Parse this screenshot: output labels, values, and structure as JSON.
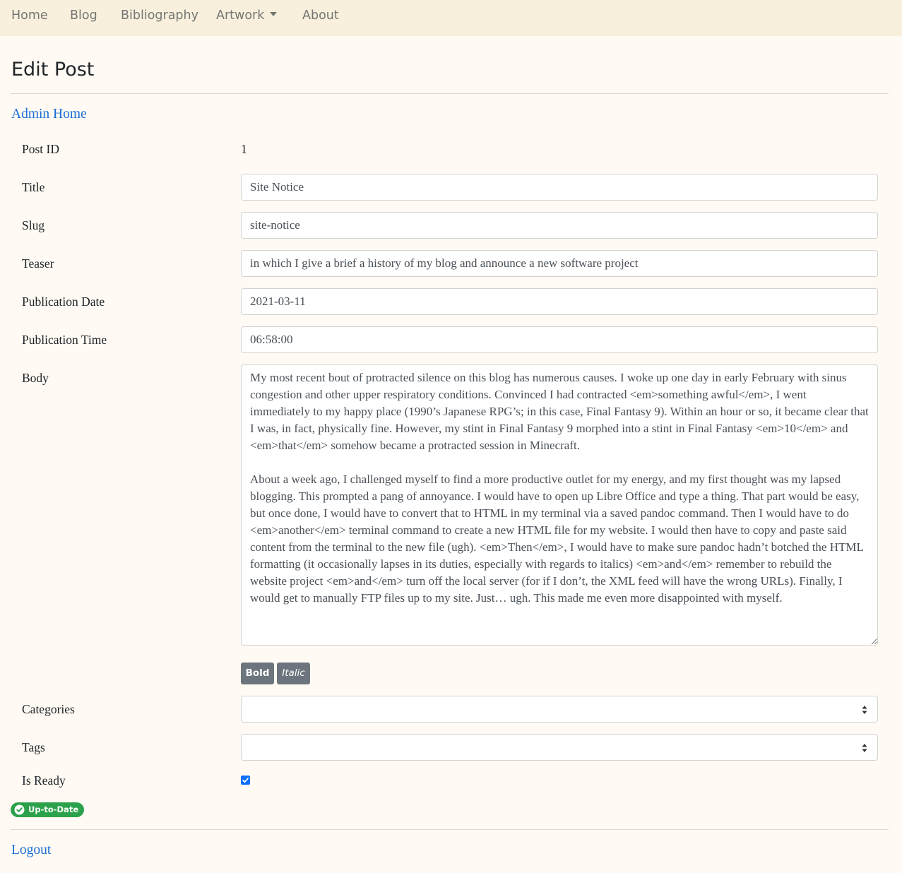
{
  "nav": {
    "items": [
      {
        "label": "Home"
      },
      {
        "label": "Blog"
      },
      {
        "label": "Bibliography"
      },
      {
        "label": "Artwork",
        "dropdown": true
      },
      {
        "label": "About"
      }
    ]
  },
  "page": {
    "title": "Edit Post",
    "admin_link": "Admin Home",
    "logout_link": "Logout"
  },
  "form": {
    "post_id_label": "Post ID",
    "post_id_value": "1",
    "title_label": "Title",
    "title_value": "Site Notice",
    "slug_label": "Slug",
    "slug_value": "site-notice",
    "teaser_label": "Teaser",
    "teaser_value": "in which I give a brief a history of my blog and announce a new software project",
    "pub_date_label": "Publication Date",
    "pub_date_value": "2021-03-11",
    "pub_time_label": "Publication Time",
    "pub_time_value": "06:58:00",
    "body_label": "Body",
    "body_value": "My most recent bout of protracted silence on this blog has numerous causes. I woke up one day in early February with sinus congestion and other upper respiratory conditions. Convinced I had contracted <em>something awful</em>, I went immediately to my happy place (1990’s Japanese RPG’s; in this case, Final Fantasy 9). Within an hour or so, it became clear that I was, in fact, physically fine. However, my stint in Final Fantasy 9 morphed into a stint in Final Fantasy <em>10</em> and <em>that</em> somehow became a protracted session in Minecraft.\n\nAbout a week ago, I challenged myself to find a more productive outlet for my energy, and my first thought was my lapsed blogging. This prompted a pang of annoyance. I would have to open up Libre Office and type a thing. That part would be easy, but once done, I would have to convert that to HTML in my terminal via a saved pandoc command. Then I would have to do <em>another</em> terminal command to create a new HTML file for my website. I would then have to copy and paste said content from the terminal to the new file (ugh). <em>Then</em>, I would have to make sure pandoc hadn’t botched the HTML formatting (it occasionally lapses in its duties, especially with regards to italics) <em>and</em> remember to rebuild the website project <em>and</em> turn off the local server (for if I don’t, the XML feed will have the wrong URLs). Finally, I would get to manually FTP files up to my site. Just… ugh. This made me even more disappointed with myself.",
    "bold_button": "Bold",
    "italic_button": "Italic",
    "categories_label": "Categories",
    "tags_label": "Tags",
    "is_ready_label": "Is Ready",
    "is_ready_checked": true,
    "status_badge": "Up-to-Date"
  },
  "colors": {
    "navbar_bg": "#f8f0dc",
    "page_bg": "#fffaf3",
    "link": "#1b6ed6",
    "button": "#6c757d",
    "badge": "#2aa14a",
    "checkbox": "#0d6efd"
  }
}
